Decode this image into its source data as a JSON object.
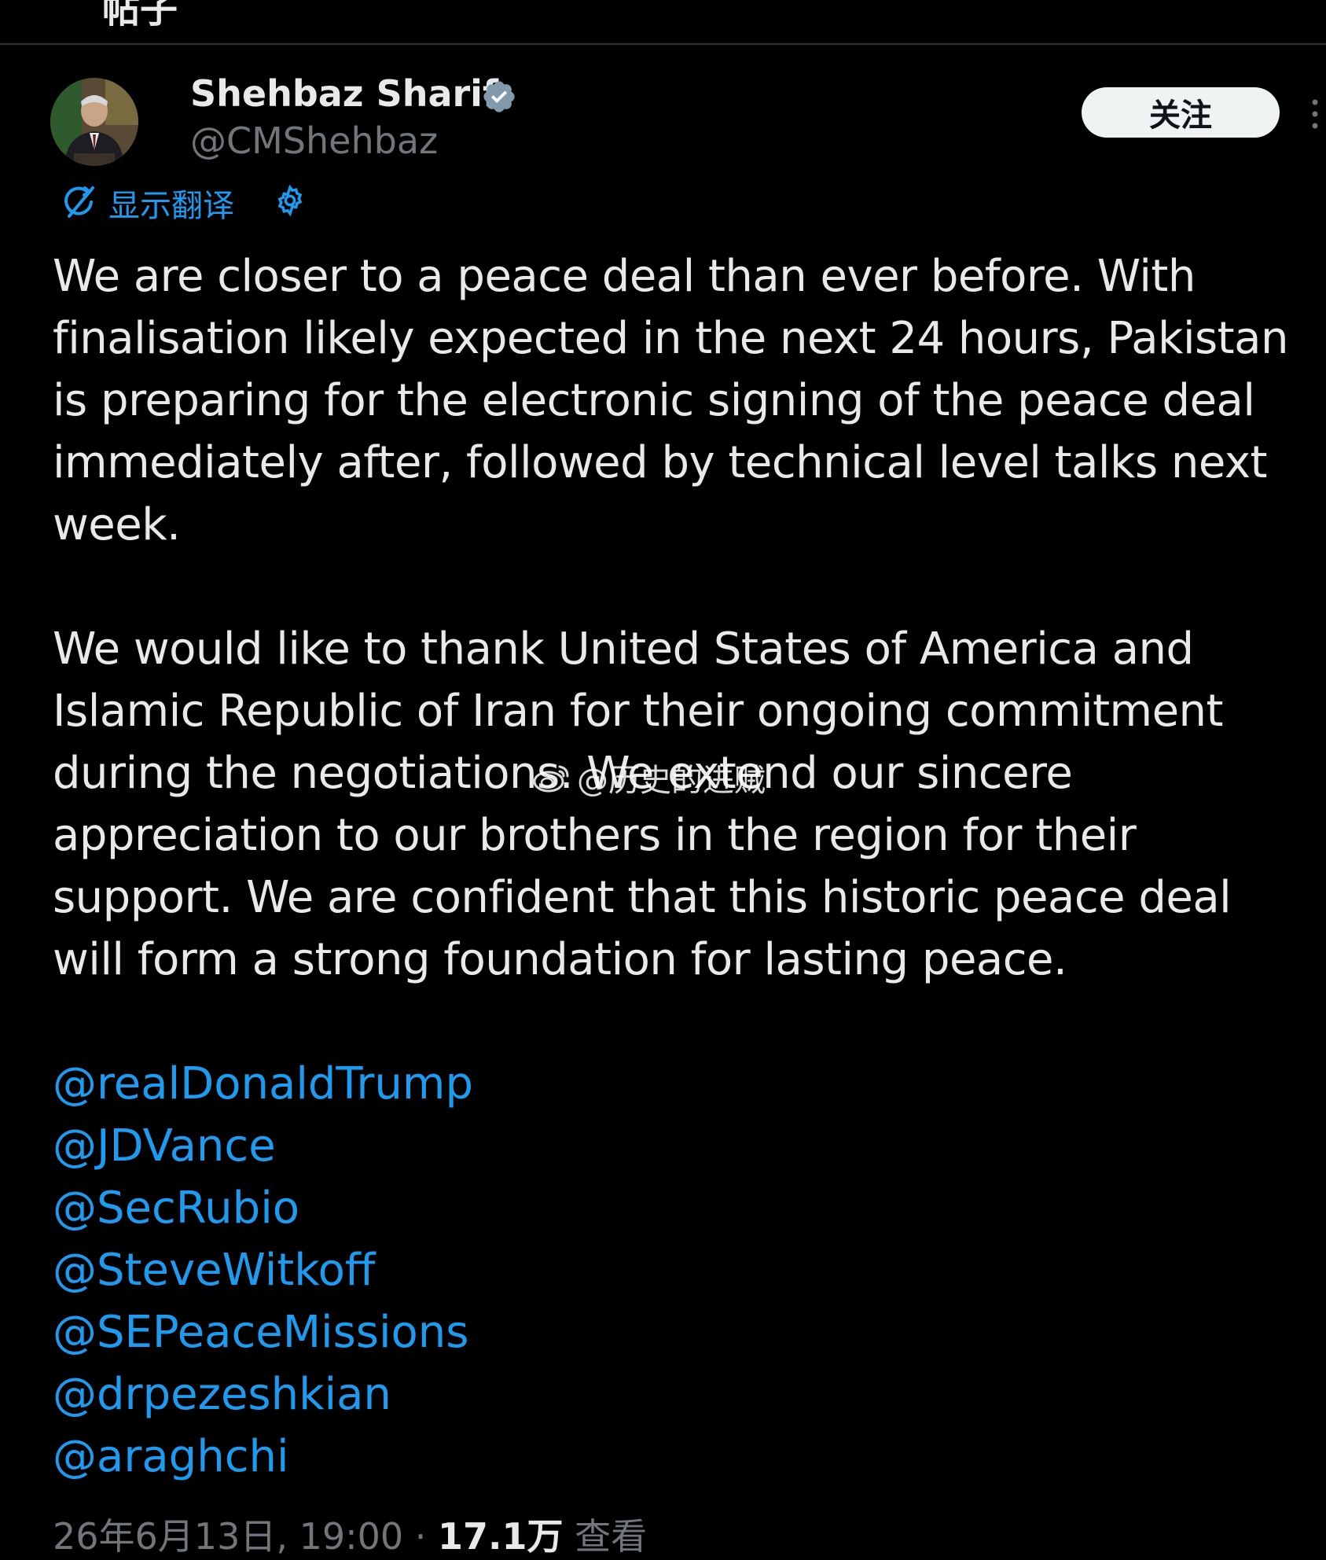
{
  "header": {
    "title": "帖子"
  },
  "author": {
    "name": "Shehbaz Sharif",
    "handle": "@CMShehbaz",
    "verified": true,
    "avatar": "avatar-photo"
  },
  "follow_button": {
    "label": "关注"
  },
  "translate": {
    "label": "显示翻译",
    "icon": "translate-icon",
    "settings_icon": "gear-icon"
  },
  "post": {
    "paragraph1": [
      "We are closer to a peace deal than ever before. With",
      "finalisation likely expected in the next 24 hours, Pakistan",
      "is preparing for the electronic signing of the peace deal",
      "immediately after, followed by technical level talks next",
      "week."
    ],
    "paragraph2": [
      "We would like to thank United States of America and",
      "Islamic Republic of Iran for their ongoing commitment",
      "during the negotiations. We extend our sincere",
      "appreciation to our brothers in the region for their",
      "support. We are confident that this historic peace deal",
      "will form a strong foundation for lasting peace."
    ],
    "mentions": [
      "@realDonaldTrump",
      "@JDVance",
      "@SecRubio",
      "@SteveWitkoff",
      "@SEPeaceMissions",
      "@drpezeshkian",
      "@araghchi"
    ]
  },
  "meta": {
    "timestamp": "26年6月13日, 19:00",
    "separator": " · ",
    "views": "17.1万",
    "views_label": " 查看"
  },
  "watermark": {
    "text": "@历史的进贼",
    "icon": "weibo-icon"
  },
  "colors": {
    "background": "#000000",
    "text": "#e7e9ea",
    "secondary": "#71767b",
    "link": "#1d9bf0",
    "follow_bg": "#eff3f4"
  }
}
